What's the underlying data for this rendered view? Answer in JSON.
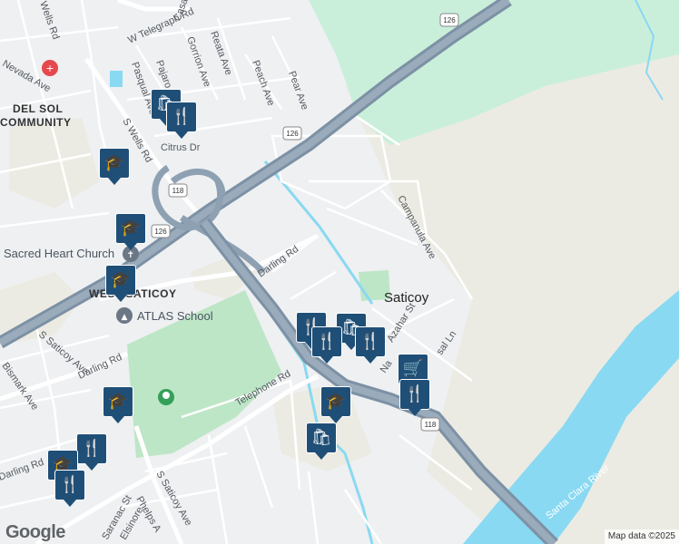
{
  "map": {
    "colors": {
      "land": "#eef0f2",
      "farmland": "#ecebe3",
      "green": "#c9efdb",
      "park": "#bde6c6",
      "water": "#89d9f2",
      "highway": "#8ea1b3",
      "road": "#ffffff",
      "marker": "#1f4f77"
    },
    "labels": {
      "w_telegraph": "W Telegraph Rd",
      "casa_st": "Casa St",
      "pajaro": "Pajaro Ave",
      "gorrion": "Gorrion Ave",
      "reata": "Reata Ave",
      "pasqual": "Pasqual Ave",
      "peach": "Peach Ave",
      "pear": "Pear Ave",
      "nevada": "Nevada Ave",
      "wells_rd_top": "Wells Rd",
      "s_wells": "S Wells Rd",
      "citrus": "Citrus Dr",
      "darling_top": "Darling Rd",
      "darling_left": "Darling Rd",
      "darling_bottom": "Darling Rd",
      "campanula": "Campanula Ave",
      "azahar": "Azahar St",
      "telephone": "Telephone Rd",
      "s_saticoy_left": "S Saticoy Ave",
      "s_saticoy_bottom": "S Saticoy Ave",
      "bismark": "Bismark Ave",
      "saranac": "Saranac St",
      "elsinore": "Elsinore",
      "phelps": "Phelps A",
      "nardo": "Na",
      "rosal": "sal Ln",
      "area_del_sol_1": "DEL SOL",
      "area_del_sol_2": "COMMUNITY",
      "area_west_saticoy": "WEST SATICOY",
      "town_saticoy": "Saticoy",
      "poi_sacred_heart": "Sacred Heart Church",
      "poi_atlas": "ATLAS School",
      "river": "Santa Clara River"
    },
    "shields": [
      "126",
      "126",
      "126",
      "118",
      "118"
    ],
    "markers": [
      {
        "id": "shop-top",
        "icon": "shopping-bag-icon"
      },
      {
        "id": "food-top",
        "icon": "fork-knife-icon"
      },
      {
        "id": "school-1",
        "icon": "school-icon"
      },
      {
        "id": "school-2",
        "icon": "school-icon"
      },
      {
        "id": "school-3",
        "icon": "school-icon"
      },
      {
        "id": "food-c1",
        "icon": "fork-knife-icon"
      },
      {
        "id": "shop-c",
        "icon": "shopping-bag-icon"
      },
      {
        "id": "food-c2",
        "icon": "fork-knife-icon"
      },
      {
        "id": "food-c3",
        "icon": "fork-knife-icon"
      },
      {
        "id": "grocery",
        "icon": "shopping-cart-icon"
      },
      {
        "id": "food-r",
        "icon": "fork-knife-icon"
      },
      {
        "id": "school-4",
        "icon": "school-icon"
      },
      {
        "id": "shop-bottom",
        "icon": "shopping-bag-icon"
      },
      {
        "id": "school-5",
        "icon": "school-icon"
      },
      {
        "id": "food-bl1",
        "icon": "fork-knife-icon"
      },
      {
        "id": "school-6",
        "icon": "school-icon"
      },
      {
        "id": "food-bl2",
        "icon": "fork-knife-icon"
      }
    ],
    "attribution": "Map data ©2025",
    "logo": "Google"
  }
}
